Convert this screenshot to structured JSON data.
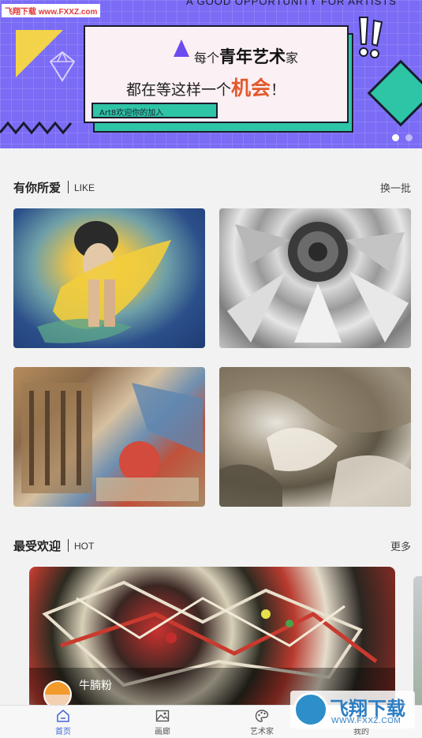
{
  "watermark": {
    "top_left": "飞翔下载 www.FXXZ.com",
    "bottom_right_title": "飞翔下载",
    "bottom_right_url": "WWW.FXXZ.COM"
  },
  "banner": {
    "top_text": "A GOOD OPPORTUNITY FOR ARTISTS",
    "line1_pre": "每个",
    "line1_bold": "青年艺术",
    "line1_post": "家",
    "line2_pre": "都在等这样一个",
    "line2_bold": "机会",
    "line2_post": "！",
    "tag": "Art8欢迎你的加入",
    "slides": 2,
    "active_slide": 1
  },
  "like_section": {
    "title": "有你所爱",
    "title_en": "LIKE",
    "action": "换一批"
  },
  "hot_section": {
    "title": "最受欢迎",
    "title_en": "HOT",
    "action": "更多",
    "card": {
      "artist": "牛腩粉"
    }
  },
  "bottom_nav": {
    "items": [
      {
        "label": "首页",
        "icon": "home-icon",
        "active": true
      },
      {
        "label": "画廊",
        "icon": "gallery-icon",
        "active": false
      },
      {
        "label": "艺术家",
        "icon": "palette-icon",
        "active": false
      },
      {
        "label": "我的",
        "icon": "user-icon",
        "active": false
      }
    ]
  },
  "colors": {
    "banner_bg": "#7b6cf6",
    "accent_green": "#2ec4a6",
    "accent_orange": "#e3592c",
    "nav_active": "#3f68d8"
  }
}
